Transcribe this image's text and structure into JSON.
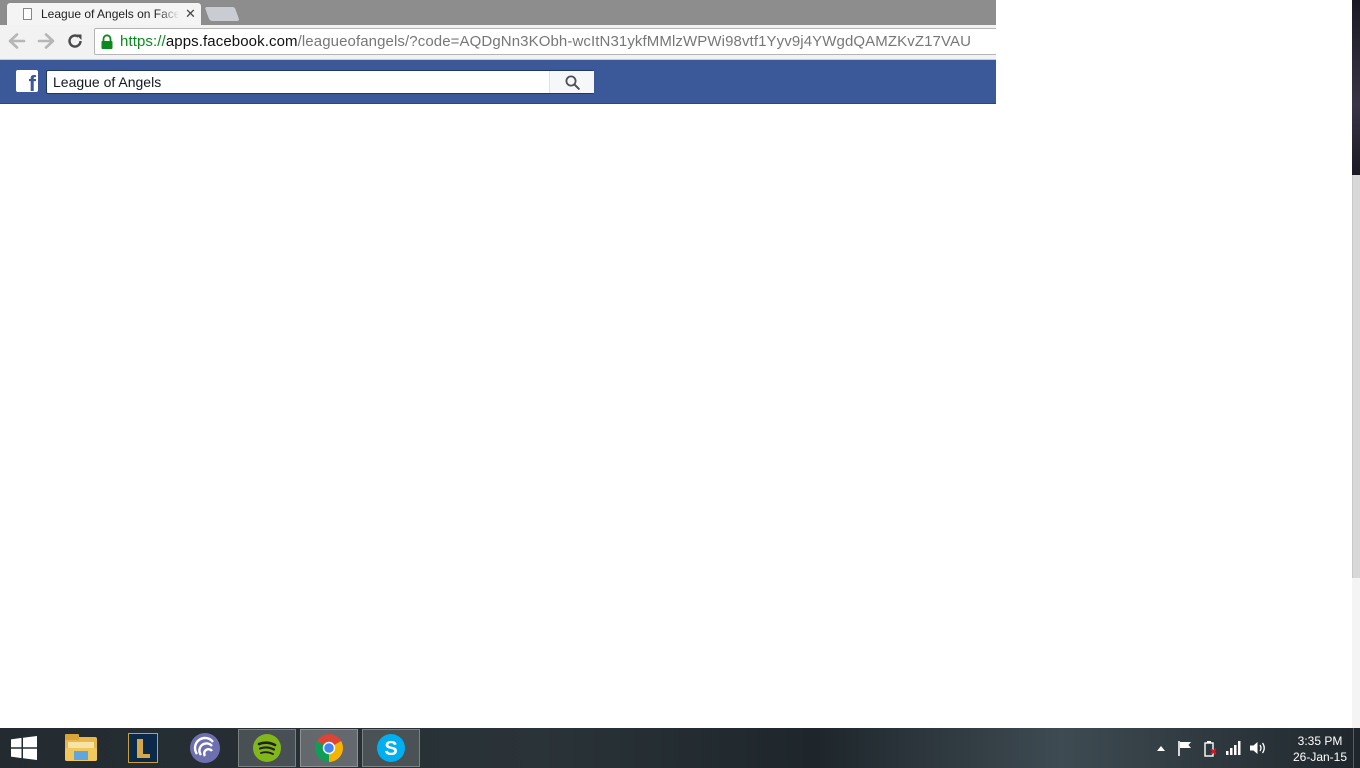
{
  "browser": {
    "tabs": [
      {
        "title": "League of Angels on Facebook",
        "active": true
      }
    ],
    "url": {
      "scheme": "https://",
      "host": "apps.facebook.com",
      "path": "/leagueofangels/?code=AQDgNn3KObh-wcItN31ykfMMlzWPWi98vtf1Yyv9j4YWgdQAMZKvZ17VAU"
    }
  },
  "facebook": {
    "search_value": "League of Angels",
    "brand_color": "#3b5998"
  },
  "taskbar": {
    "apps": [
      "file-explorer",
      "league-of-legends",
      "bittorrent",
      "spotify",
      "chrome",
      "skype"
    ],
    "clock": {
      "time": "3:35 PM",
      "date": "26-Jan-15"
    }
  }
}
